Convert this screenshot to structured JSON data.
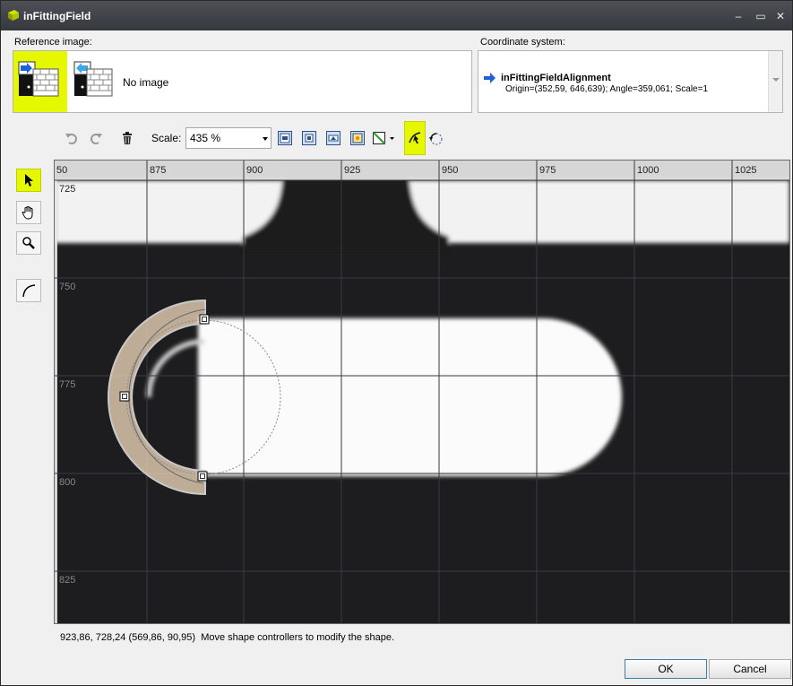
{
  "window": {
    "title": "inFittingField",
    "controls": {
      "minimize": "–",
      "maximize": "▭",
      "close": "✕"
    }
  },
  "reference": {
    "label": "Reference image:",
    "no_image_text": "No image"
  },
  "coordinate_system": {
    "label": "Coordinate system:",
    "name": "inFittingFieldAlignment",
    "detail": "Origin=(352,59, 646,639); Angle=359,061; Scale=1"
  },
  "toolbar": {
    "scale_label": "Scale:",
    "scale_value": "435 %"
  },
  "canvas": {
    "ruler_x": [
      "50",
      "875",
      "900",
      "925",
      "950",
      "975",
      "1000",
      "1025"
    ],
    "ruler_y": [
      "725",
      "750",
      "775",
      "800",
      "825"
    ]
  },
  "status": {
    "coords": "923,86, 728,24 (569,86, 90,95)",
    "hint": "Move shape controllers to modify the shape."
  },
  "buttons": {
    "ok": "OK",
    "cancel": "Cancel"
  },
  "colors": {
    "accent": "#e6f800",
    "arrow_blue": "#1e5fe0",
    "arc_fill": "#f4dcc0"
  }
}
